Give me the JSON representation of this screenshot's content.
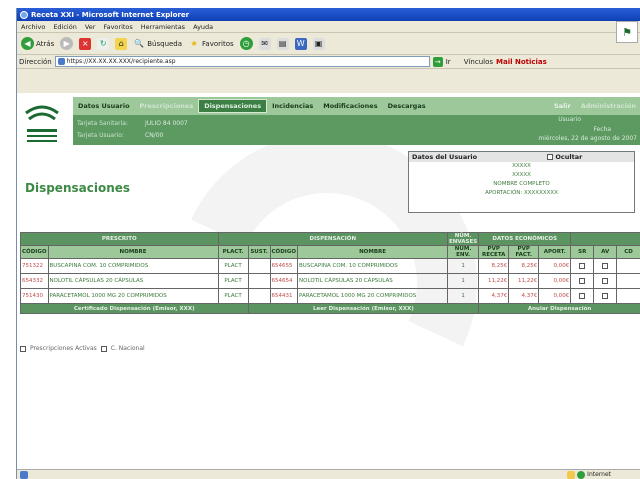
{
  "window": {
    "title": "Receta XXI - Microsoft Internet Explorer"
  },
  "menu": [
    "Archivo",
    "Edición",
    "Ver",
    "Favoritos",
    "Herramientas",
    "Ayuda"
  ],
  "toolbar": {
    "back": "Atrás",
    "search": "Búsqueda",
    "favorites": "Favoritos"
  },
  "address": {
    "label": "Dirección",
    "url": "https://XX.XX.XX.XXX/recipiente.asp",
    "go": "Ir",
    "links": "Vínculos",
    "notice": "Mail Noticias"
  },
  "nav": [
    "Datos Usuario",
    "Prescripciones",
    "Dispensaciones",
    "Incidencias",
    "Modificaciones",
    "Descargas",
    "Salir",
    "Administración"
  ],
  "info": {
    "row1_label": "Tarjeta Sanitaria:",
    "row1_value": "JULIO 84 0007",
    "row2_label": "Tarjeta Usuario:",
    "row2_value": "CN/00",
    "right1": "Usuario",
    "right2": "Fecha",
    "right3": "miércoles, 22 de agosto de 2007"
  },
  "page_title": "Dispensaciones",
  "userbox": {
    "title": "Datos del Usuario",
    "toggle": "Ocultar",
    "lines": [
      "XXXXX",
      "XXXXX",
      "NOMBRE COMPLETO",
      "APORTACIÓN: XXXXXXXXX"
    ]
  },
  "table": {
    "group1": "PRESCRITO",
    "group2": "DISPENSACIÓN",
    "group3": "NÚM. ENVASES",
    "group4": "DATOS ECONÓMICOS",
    "headers": [
      "CÓDIGO",
      "NOMBRE",
      "PLACT.",
      "SUST.",
      "CÓDIGO",
      "NOMBRE",
      "NÚM. ENV.",
      "PVP RECETA",
      "PVP FACT.",
      "APORT.",
      "SR",
      "AV",
      "CD"
    ],
    "rows": [
      {
        "code": "751322",
        "name": "BUSCAPINA COM. 10 COMPRIMIDOS",
        "plact": "PLACT",
        "sust": "",
        "code2": "654655",
        "name2": "BUSCAPINA COM. 10 COMPRIMIDOS",
        "env": "1",
        "pvp": "8,25€",
        "fact": "8,25€",
        "aport": "0,00€"
      },
      {
        "code": "654332",
        "name": "NOLOTIL CÁPSULAS 20 CÁPSULAS",
        "plact": "PLACT",
        "sust": "",
        "code2": "654654",
        "name2": "NOLOTIL CÁPSULAS 20 CÁPSULAS",
        "env": "1",
        "pvp": "11,22€",
        "fact": "11,22€",
        "aport": "0,00€"
      },
      {
        "code": "751430",
        "name": "PARACETAMOL 1000 MG 20 COMPRIMIDOS",
        "plact": "PLACT",
        "sust": "",
        "code2": "654431",
        "name2": "PARACETAMOL 1000 MG 20 COMPRIMIDOS",
        "env": "1",
        "pvp": "4,37€",
        "fact": "4,37€",
        "aport": "0,00€"
      }
    ],
    "buttons": [
      "Certificado Dispensación (Emisor, XXX)",
      "Leer Dispensación (Emisor, XXX)",
      "Anular Dispensación"
    ]
  },
  "checks": [
    "Prescripciones Activas",
    "C. Nacional"
  ],
  "status": {
    "zone": "Internet"
  },
  "colors": {
    "nav": "#9cc89a",
    "header": "#5b9461",
    "title": "#3d8a45"
  }
}
